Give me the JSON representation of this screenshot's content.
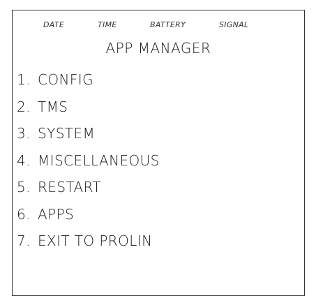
{
  "status_bar": {
    "date": "DATE",
    "time": "TIME",
    "battery": "BATTERY",
    "signal": "SIGNAL"
  },
  "title": "APP MANAGER",
  "menu": {
    "items": [
      {
        "number": "1.",
        "label": "CONFIG"
      },
      {
        "number": "2.",
        "label": "TMS"
      },
      {
        "number": "3.",
        "label": "SYSTEM"
      },
      {
        "number": "4.",
        "label": "MISCELLANEOUS"
      },
      {
        "number": "5.",
        "label": "RESTART"
      },
      {
        "number": "6.",
        "label": "APPS"
      },
      {
        "number": "7.",
        "label": "EXIT TO PROLIN"
      }
    ]
  },
  "colors": {
    "background": "#ffffff",
    "text": "#1a1a1a",
    "border": "#333333"
  }
}
